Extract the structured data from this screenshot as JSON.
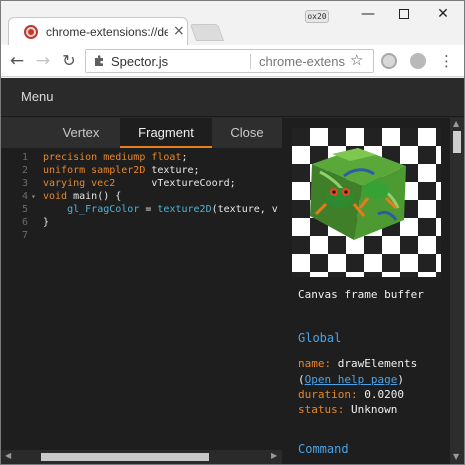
{
  "browser": {
    "tab_title": "chrome-extensions://denb",
    "tab_close": "×",
    "profile_badge": "ox20",
    "omnibox_label": "Spector.js",
    "omnibox_url": "chrome-extension://denbga...",
    "controls": {
      "minimize": "—",
      "close": "✕"
    },
    "nav": {
      "back": "←",
      "forward": "→",
      "reload": "↻",
      "star": "☆",
      "menu": "⋮"
    }
  },
  "spector": {
    "menu_label": "Menu",
    "shader_tabs": [
      {
        "label": "Vertex"
      },
      {
        "label": "Fragment"
      },
      {
        "label": "Close"
      }
    ],
    "code_lines": [
      {
        "num": "1",
        "fold": "",
        "tokens": [
          {
            "t": "kw",
            "s": "precision mediump float"
          },
          {
            "t": "plain",
            "s": ";"
          }
        ]
      },
      {
        "num": "2",
        "fold": "",
        "tokens": [
          {
            "t": "kw",
            "s": "uniform sampler2D "
          },
          {
            "t": "plain",
            "s": "texture;"
          }
        ]
      },
      {
        "num": "3",
        "fold": "",
        "tokens": [
          {
            "t": "kw",
            "s": "varying vec2      "
          },
          {
            "t": "plain",
            "s": "vTextureCoord;"
          }
        ]
      },
      {
        "num": "4",
        "fold": "▾",
        "tokens": [
          {
            "t": "kw",
            "s": "void "
          },
          {
            "t": "plain",
            "s": "main() {"
          }
        ]
      },
      {
        "num": "5",
        "fold": "",
        "tokens": [
          {
            "t": "plain",
            "s": "    "
          },
          {
            "t": "fn",
            "s": "gl_FragColor"
          },
          {
            "t": "plain",
            "s": " = "
          },
          {
            "t": "fn",
            "s": "texture2D"
          },
          {
            "t": "plain",
            "s": "(texture, v"
          }
        ]
      },
      {
        "num": "6",
        "fold": "",
        "tokens": [
          {
            "t": "plain",
            "s": "}"
          }
        ]
      },
      {
        "num": "7",
        "fold": "",
        "tokens": []
      }
    ],
    "canvas_caption": "Canvas frame buffer",
    "global": {
      "title": "Global",
      "name_key": "name: ",
      "name_value": "drawElements",
      "help_open": "(",
      "help_link": "Open help page",
      "help_close": ")",
      "duration_key": "duration: ",
      "duration_value": "0.0200",
      "status_key": "status: ",
      "status_value": "Unknown"
    },
    "command_title": "Command"
  },
  "colors": {
    "keyword": "#e6872c",
    "function": "#4fb3d9",
    "link": "#4aa3e8",
    "active_tab_underline": "#e67e22",
    "panel_bg": "#1e1e1e"
  },
  "icons": {
    "tab_favicon": "spector-favicon-icon",
    "omnibox": "puzzle-extension-icon",
    "star": "star-icon",
    "kebab": "more-vert-icon"
  }
}
